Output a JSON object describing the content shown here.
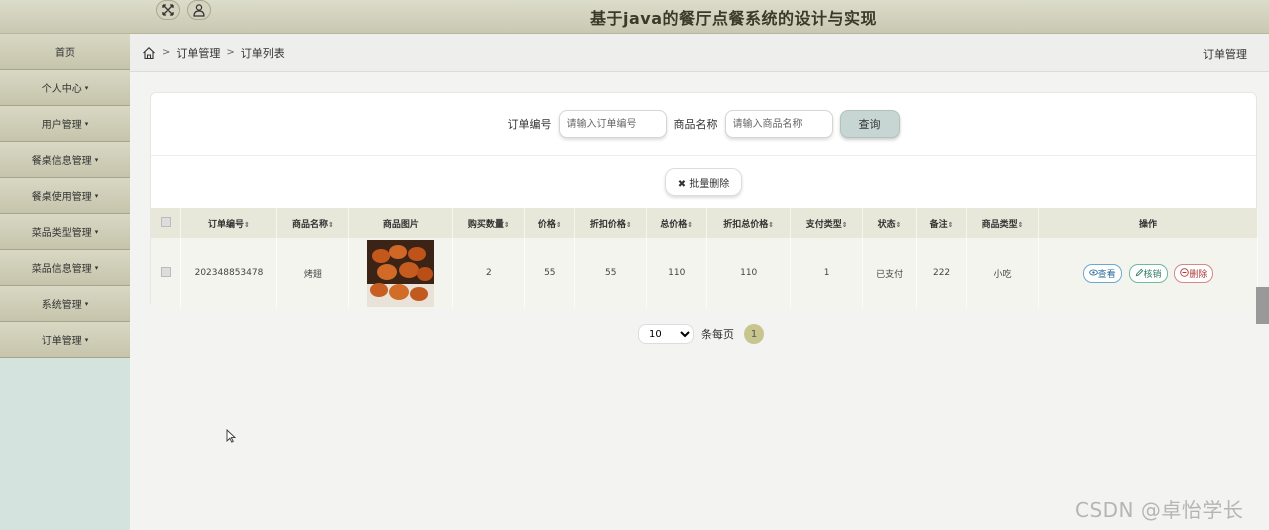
{
  "app": {
    "title": "基于java的餐厅点餐系统的设计与实现"
  },
  "topbar": {
    "icons": [
      "fullscreen-icon",
      "user-icon"
    ]
  },
  "sidebar": {
    "items": [
      {
        "label": "首页",
        "has_caret": false
      },
      {
        "label": "个人中心",
        "has_caret": true
      },
      {
        "label": "用户管理",
        "has_caret": true
      },
      {
        "label": "餐桌信息管理",
        "has_caret": true
      },
      {
        "label": "餐桌使用管理",
        "has_caret": true
      },
      {
        "label": "菜品类型管理",
        "has_caret": true
      },
      {
        "label": "菜品信息管理",
        "has_caret": true
      },
      {
        "label": "系统管理",
        "has_caret": true
      },
      {
        "label": "订单管理",
        "has_caret": true
      }
    ],
    "caret": "▾"
  },
  "breadcrumb": {
    "sep": ">",
    "level1": "订单管理",
    "level2": "订单列表",
    "right": "订单管理"
  },
  "search": {
    "order_no_label": "订单编号",
    "order_no_placeholder": "请输入订单编号",
    "product_label": "商品名称",
    "product_placeholder": "请输入商品名称",
    "query_button": "查询"
  },
  "actions": {
    "batch_delete": "批量删除",
    "batch_delete_icon": "✖"
  },
  "table": {
    "sort_glyph": "⇕",
    "headers": [
      "订单编号",
      "商品名称",
      "商品图片",
      "购买数量",
      "价格",
      "折扣价格",
      "总价格",
      "折扣总价格",
      "支付类型",
      "状态",
      "备注",
      "商品类型",
      "操作"
    ],
    "rows": [
      {
        "order_no": "202348853478",
        "product_name": "烤翅",
        "quantity": "2",
        "price": "55",
        "discount_price": "55",
        "total_price": "110",
        "discount_total": "110",
        "pay_type": "1",
        "status": "已支付",
        "remark": "222",
        "product_type": "小吃",
        "ops": {
          "view": "查看",
          "cancel": "核销",
          "delete": "删除"
        }
      }
    ]
  },
  "pagination": {
    "page_size": "10",
    "page_size_options": [
      "10"
    ],
    "per_page_label": "条每页",
    "current_page": "1"
  },
  "watermark": "CSDN @卓怡学长"
}
